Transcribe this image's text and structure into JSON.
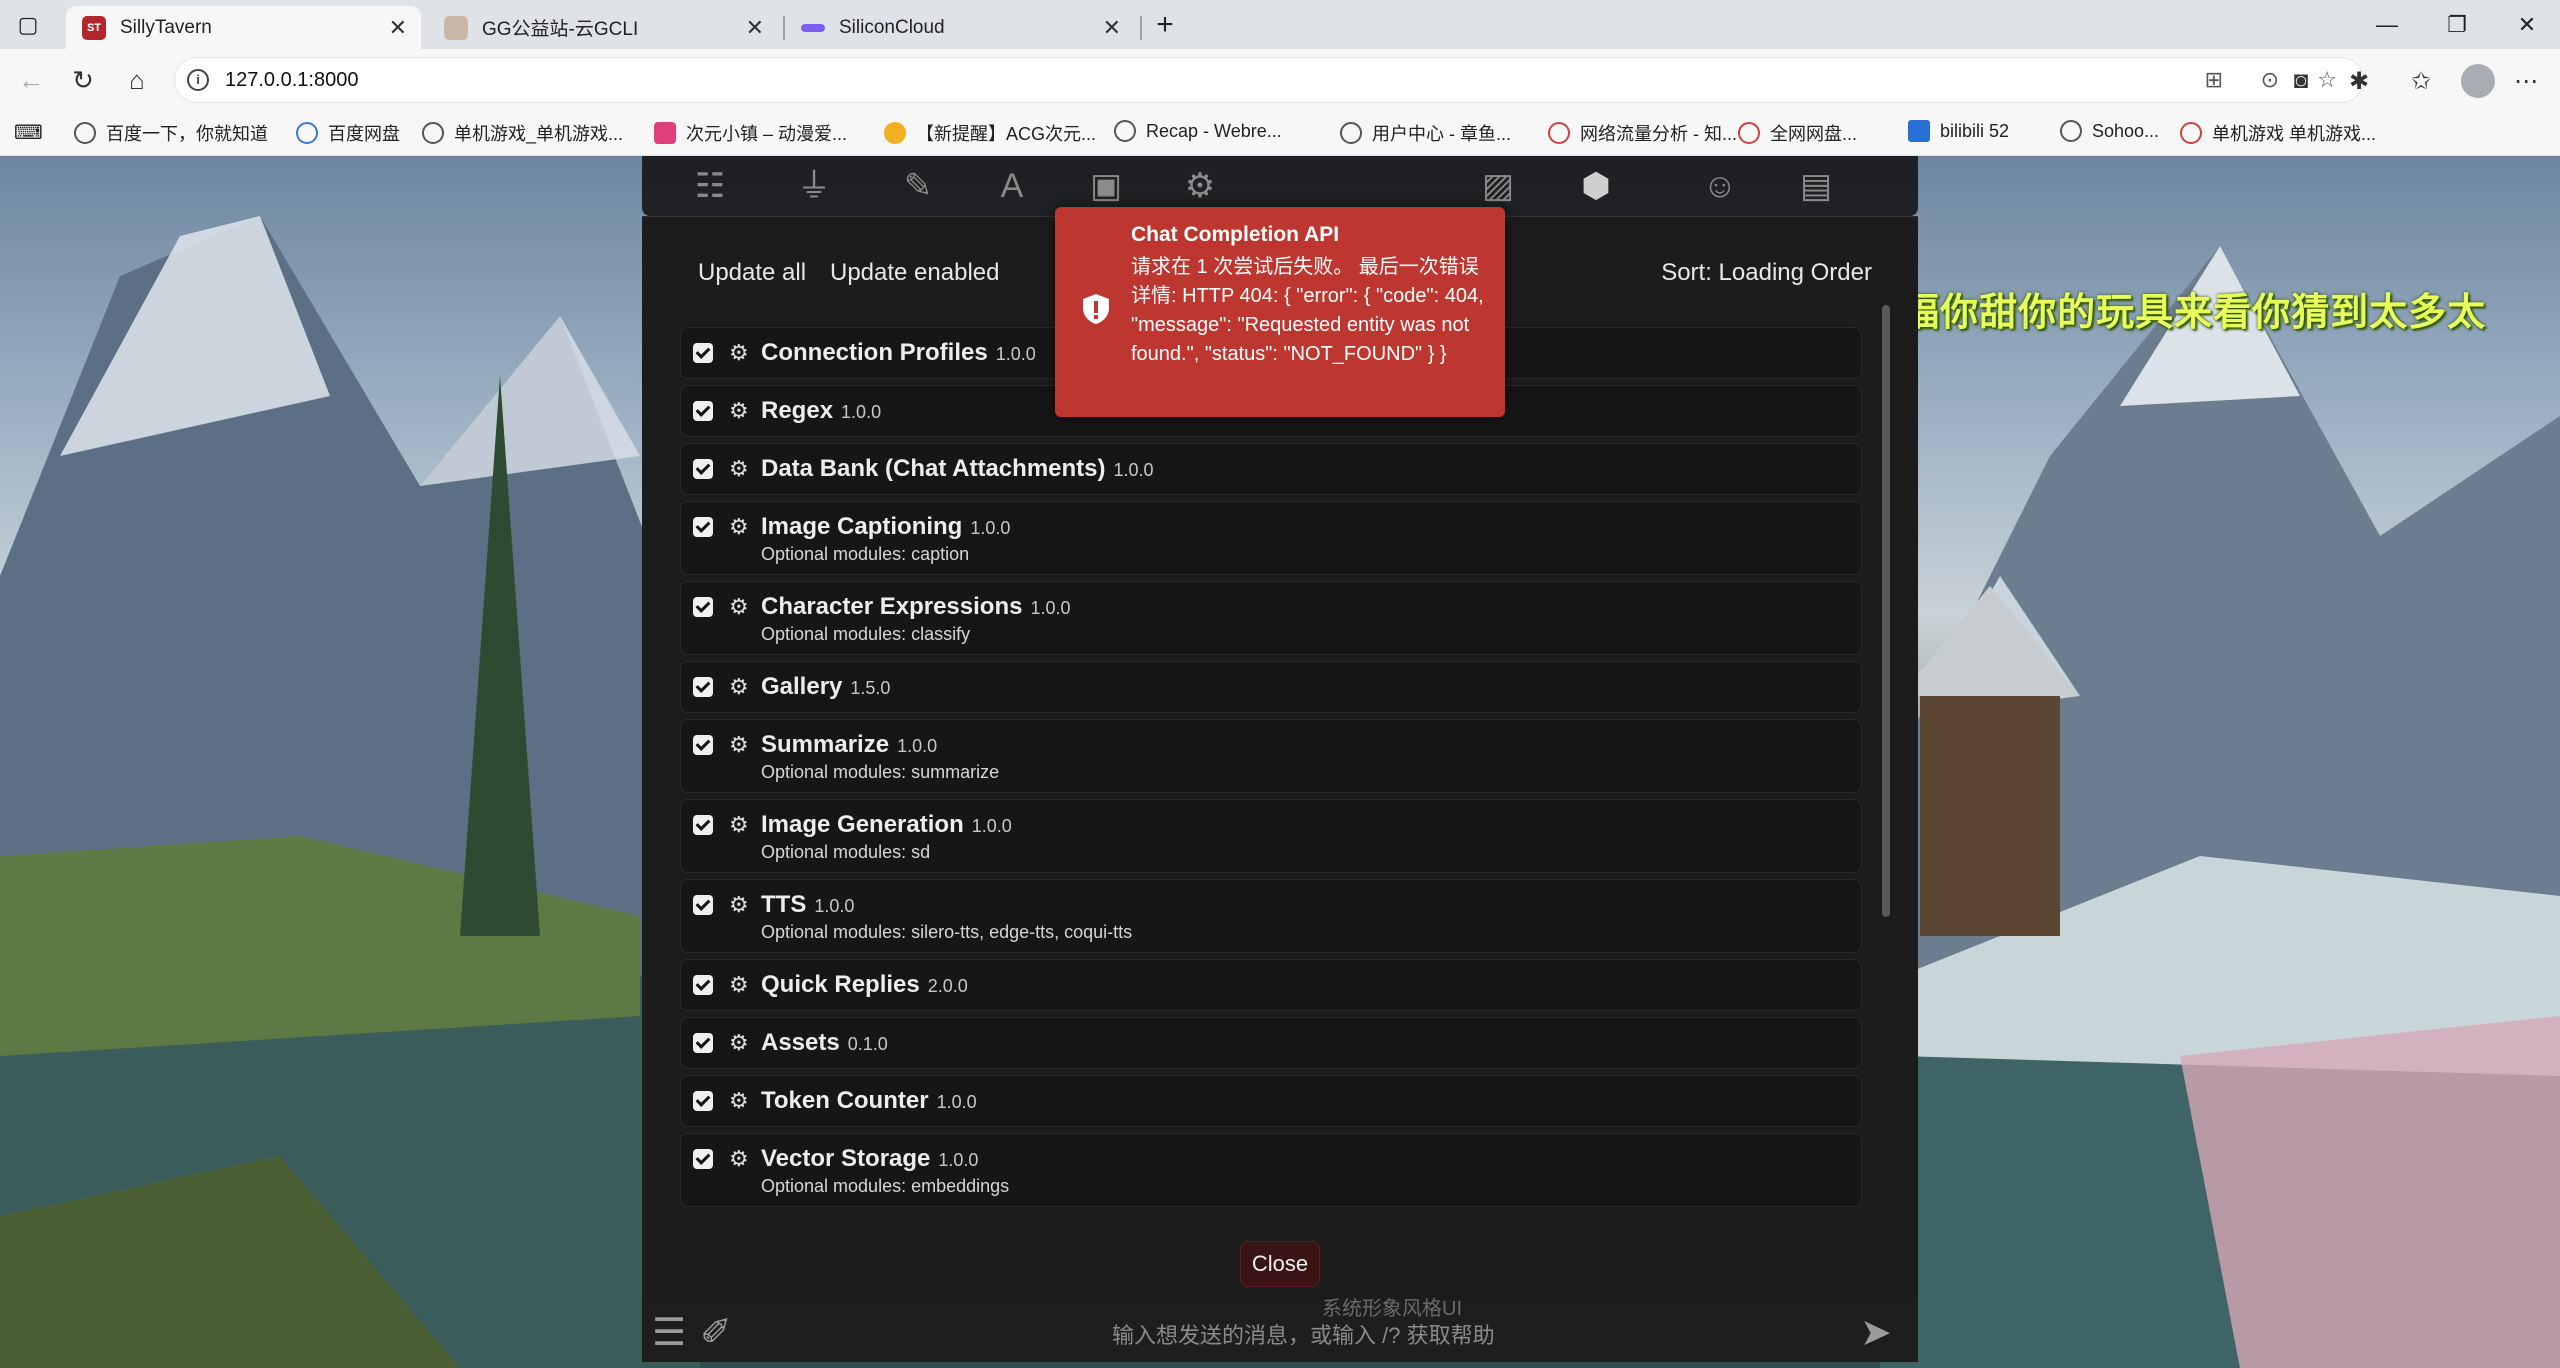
{
  "browser": {
    "tabs": [
      {
        "title": "SillyTavern",
        "active": true,
        "favicon": "ST"
      },
      {
        "title": "GG公益站-云GCLI",
        "active": false
      },
      {
        "title": "SiliconCloud",
        "active": false
      }
    ],
    "url": "127.0.0.1:8000",
    "bookmarks": [
      "百度一下，你就知道",
      "百度网盘",
      "单机游戏_单机游戏...",
      "次元小镇 – 动漫爱...",
      "【新提醒】ACG次元...",
      "Recap - Webre...",
      "用户中心 - 章鱼...",
      "网络流量分析 - 知...",
      "全网网盘...",
      "bilibili 52",
      "Sohoo...",
      "单机游戏 单机游戏..."
    ]
  },
  "overlay": {
    "danmaku": "独享每一个魔搭sing听魔将你的所有感记的祝福你甜你的玩具来看你猜到太多太"
  },
  "toast": {
    "title": "Chat Completion API",
    "message": "请求在 1 次尝试后失败。 最后一次错误详情: HTTP 404: { \"error\": { \"code\": 404, \"message\": \"Requested entity was not found.\", \"status\": \"NOT_FOUND\" } }",
    "color": "#bd362f"
  },
  "extensions": {
    "update_all": "Update all",
    "update_enabled": "Update enabled",
    "sort": "Sort: Loading Order",
    "items": [
      {
        "name": "Connection Profiles",
        "version": "1.0.0",
        "enabled": true,
        "optional": ""
      },
      {
        "name": "Regex",
        "version": "1.0.0",
        "enabled": true,
        "optional": ""
      },
      {
        "name": "Data Bank (Chat Attachments)",
        "version": "1.0.0",
        "enabled": true,
        "optional": ""
      },
      {
        "name": "Image Captioning",
        "version": "1.0.0",
        "enabled": true,
        "optional": "Optional modules: caption"
      },
      {
        "name": "Character Expressions",
        "version": "1.0.0",
        "enabled": true,
        "optional": "Optional modules: classify"
      },
      {
        "name": "Gallery",
        "version": "1.5.0",
        "enabled": true,
        "optional": ""
      },
      {
        "name": "Summarize",
        "version": "1.0.0",
        "enabled": true,
        "optional": "Optional modules: summarize"
      },
      {
        "name": "Image Generation",
        "version": "1.0.0",
        "enabled": true,
        "optional": "Optional modules: sd"
      },
      {
        "name": "TTS",
        "version": "1.0.0",
        "enabled": true,
        "optional": "Optional modules: silero-tts, edge-tts, coqui-tts"
      },
      {
        "name": "Quick Replies",
        "version": "2.0.0",
        "enabled": true,
        "optional": ""
      },
      {
        "name": "Assets",
        "version": "0.1.0",
        "enabled": true,
        "optional": ""
      },
      {
        "name": "Token Counter",
        "version": "1.0.0",
        "enabled": true,
        "optional": ""
      },
      {
        "name": "Vector Storage",
        "version": "1.0.0",
        "enabled": true,
        "optional": "Optional modules: embeddings"
      }
    ],
    "close": "Close"
  },
  "chat": {
    "placeholder": "输入想发送的消息，或输入 /? 获取帮助",
    "hidden_text": "系统形象风格UI"
  },
  "topnav_icons": [
    "sliders-icon",
    "plug-icon",
    "pen-icon",
    "font-icon",
    "book-icon",
    "user-cog-icon",
    "image-icon",
    "cubes-icon",
    "smile-icon",
    "id-card-icon"
  ]
}
